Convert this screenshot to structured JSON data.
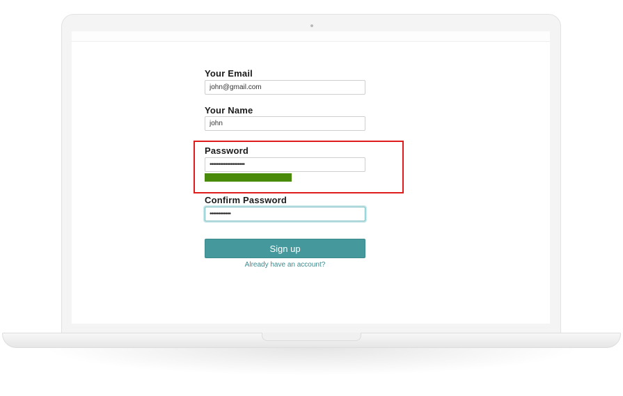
{
  "form": {
    "email": {
      "label": "Your Email",
      "value": "john@gmail.com"
    },
    "name": {
      "label": "Your Name",
      "value": "john"
    },
    "password": {
      "label": "Password",
      "value": "••••••••••••••••••••",
      "strength_fraction": 0.54,
      "strength_color": "#4a8a0b"
    },
    "confirm_password": {
      "label": "Confirm Password",
      "value": "••••••••••••"
    },
    "submit_label": "Sign up",
    "login_link": "Already have an account?"
  },
  "colors": {
    "accent": "#45999c",
    "highlight": "#e01b1b",
    "link": "#3b8a8d"
  }
}
